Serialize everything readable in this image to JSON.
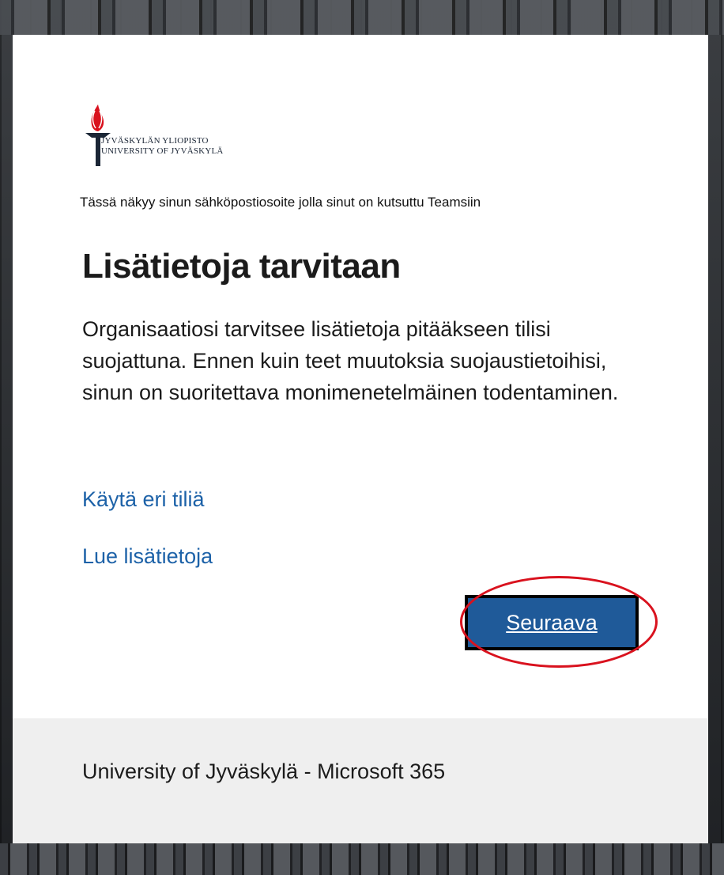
{
  "logo": {
    "line1": "JYVÄSKYLÄN YLIOPISTO",
    "line2": "UNIVERSITY OF JYVÄSKYLÄ",
    "icon": "torch-icon",
    "color_flame": "#d9121e",
    "color_torch": "#1b2636"
  },
  "notice": "Tässä näkyy sinun sähköpostiosoite jolla sinut on kutsuttu Teamsiin",
  "title": "Lisätietoja tarvitaan",
  "description": "Organisaatiosi tarvitsee lisätietoja pitääkseen tilisi suojattuna. Ennen kuin teet muutoksia suojaustietoihisi, sinun on suoritettava monimenetelmäinen todentaminen.",
  "links": {
    "other_account": "Käytä eri tiliä",
    "more_info": "Lue lisätietoja"
  },
  "next_button": "Seuraava",
  "footer": "University of Jyväskylä - Microsoft 365",
  "colors": {
    "link": "#1d62a8",
    "button": "#1f5a99",
    "highlight_circle": "#d9121e"
  }
}
